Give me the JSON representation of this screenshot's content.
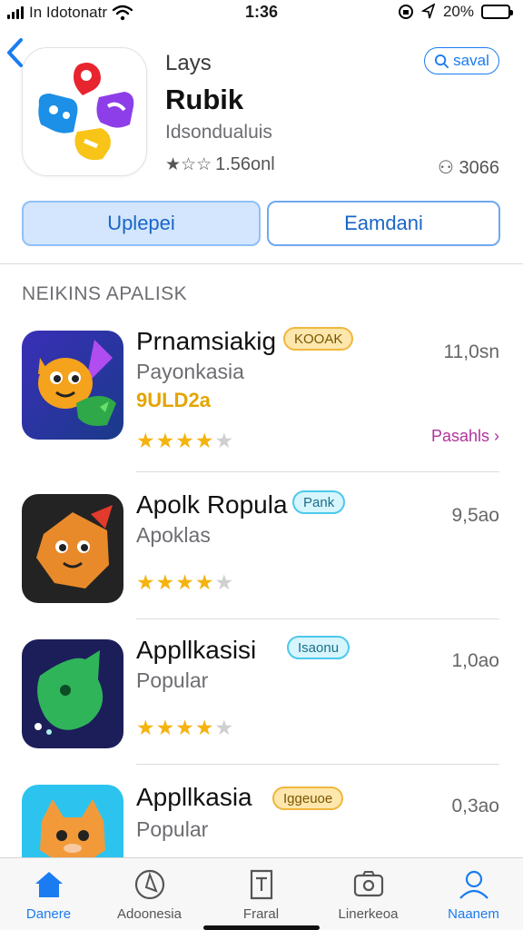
{
  "status_bar": {
    "carrier": "In Idotonatr",
    "time": "1:36",
    "battery": "20%"
  },
  "app": {
    "subtitle": "Lays",
    "title": "Rubik",
    "developer": "Idsondualuis",
    "rating_text": "1.56onl",
    "count_text": "3066",
    "search_label": "saval",
    "primary_button": "Uplepei",
    "secondary_button": "Eamdani"
  },
  "section": {
    "title": "NEIKINS APALISK"
  },
  "apps": [
    {
      "name": "Prnamsiakig",
      "tag": "KOOAK",
      "tag_color": "yellow",
      "category": "Payonkasia",
      "subtitle": "9ULD2a",
      "rating": 4,
      "size": "11,0sn",
      "link": "Pasahls",
      "icon": "dragon-app-icon"
    },
    {
      "name": "Apolk Ropula",
      "tag": "Pank",
      "tag_color": "cyan",
      "category": "Apoklas",
      "rating": 4,
      "size": "9,5ao",
      "icon": "fox-app-icon"
    },
    {
      "name": "Appllkasisi",
      "tag": "Isaonu",
      "tag_color": "cyan",
      "category": "Popular",
      "rating": 4,
      "size": "1,0ao",
      "icon": "leaf-app-icon"
    },
    {
      "name": "Appllkasia",
      "tag": "Iggeuoe",
      "tag_color": "yellow",
      "category": "Popular",
      "size": "0,3ao",
      "icon": "cat-app-icon"
    }
  ],
  "tabs": [
    {
      "label": "Danere",
      "icon": "home-icon",
      "active": true
    },
    {
      "label": "Adoonesia",
      "icon": "compass-icon",
      "active": false
    },
    {
      "label": "Fraral",
      "icon": "document-icon",
      "active": false
    },
    {
      "label": "Linerkeoa",
      "icon": "camera-icon",
      "active": false
    },
    {
      "label": "Naanem",
      "icon": "person-icon",
      "active": true
    }
  ],
  "colors": {
    "accent": "#1a7cf0",
    "star": "#f5b30f",
    "link": "#b0339b"
  }
}
